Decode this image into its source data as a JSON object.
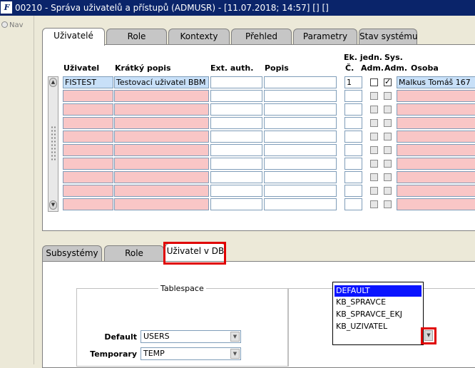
{
  "window": {
    "app_logo": "F",
    "title": "00210 - Správa uživatelů a přístupů (ADMUSR) - [11.07.2018; 14:57] [] []",
    "nav_label": "Nav"
  },
  "top_tabs": [
    "Uživatelé",
    "Role",
    "Kontexty",
    "Přehled",
    "Parametry",
    "Stav systému"
  ],
  "grid": {
    "headers": {
      "user": "Uživatel",
      "short_desc": "Krátký popis",
      "ext_auth": "Ext. auth.",
      "desc": "Popis",
      "unit_no_top": "Ek. jedn.",
      "unit_no_bottom": "Č.",
      "unit_adm": "Adm.",
      "sys_top": "Sys.",
      "sys_adm": "Adm.",
      "person": "Osoba"
    },
    "rows": [
      {
        "user": "FISTEST",
        "short_desc": "Testovací uživatel BBM",
        "ext_auth": "",
        "desc": "",
        "unit_no": "1",
        "unit_adm": false,
        "sys_adm": true,
        "person": "Malkus Tomáš 167"
      },
      {
        "user": "",
        "short_desc": "",
        "ext_auth": "",
        "desc": "",
        "unit_no": "",
        "unit_adm": false,
        "sys_adm": false,
        "person": ""
      },
      {
        "user": "",
        "short_desc": "",
        "ext_auth": "",
        "desc": "",
        "unit_no": "",
        "unit_adm": false,
        "sys_adm": false,
        "person": ""
      },
      {
        "user": "",
        "short_desc": "",
        "ext_auth": "",
        "desc": "",
        "unit_no": "",
        "unit_adm": false,
        "sys_adm": false,
        "person": ""
      },
      {
        "user": "",
        "short_desc": "",
        "ext_auth": "",
        "desc": "",
        "unit_no": "",
        "unit_adm": false,
        "sys_adm": false,
        "person": ""
      },
      {
        "user": "",
        "short_desc": "",
        "ext_auth": "",
        "desc": "",
        "unit_no": "",
        "unit_adm": false,
        "sys_adm": false,
        "person": ""
      },
      {
        "user": "",
        "short_desc": "",
        "ext_auth": "",
        "desc": "",
        "unit_no": "",
        "unit_adm": false,
        "sys_adm": false,
        "person": ""
      },
      {
        "user": "",
        "short_desc": "",
        "ext_auth": "",
        "desc": "",
        "unit_no": "",
        "unit_adm": false,
        "sys_adm": false,
        "person": ""
      },
      {
        "user": "",
        "short_desc": "",
        "ext_auth": "",
        "desc": "",
        "unit_no": "",
        "unit_adm": false,
        "sys_adm": false,
        "person": ""
      },
      {
        "user": "",
        "short_desc": "",
        "ext_auth": "",
        "desc": "",
        "unit_no": "",
        "unit_adm": false,
        "sys_adm": false,
        "person": ""
      }
    ]
  },
  "bottom_tabs": [
    "Subsystémy",
    "Role",
    "Uživatel v DB"
  ],
  "tablespace": {
    "title": "Tablespace",
    "default_label": "Default",
    "default_value": "USERS",
    "temporary_label": "Temporary",
    "temporary_value": "TEMP"
  },
  "profile_list": {
    "items": [
      "DEFAULT",
      "KB_SPRAVCE",
      "KB_SPRAVCE_EKJ",
      "KB_UZIVATEL"
    ],
    "selected": "DEFAULT"
  },
  "colors": {
    "titlebar": "#0a246a",
    "empty_row": "#f9c6c6",
    "selected_row": "#c8e0f8",
    "list_highlight": "#0a14ff",
    "annotation": "#e00000"
  }
}
